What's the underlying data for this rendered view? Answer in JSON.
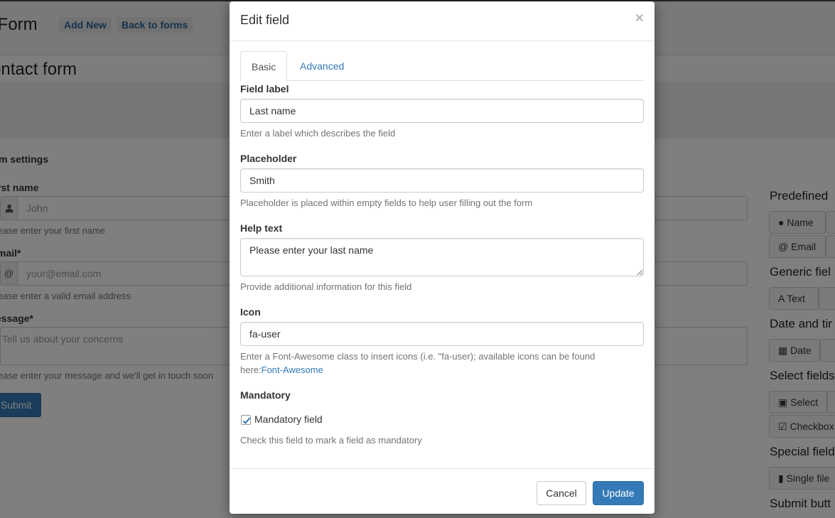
{
  "background": {
    "page_title": "it Form",
    "add_new": "Add New",
    "back_to_forms": "Back to forms",
    "form_title": "ontact form",
    "section_title": "orm settings",
    "fields": {
      "first_name_label": "rst name",
      "first_name_placeholder": "John",
      "first_name_help": "ease enter your first name",
      "email_label": "mail*",
      "email_addon": "@",
      "email_placeholder": "your@email.com",
      "email_help": "ease enter a valid email address",
      "message_label": "essage*",
      "message_placeholder": "Tell us about your concerns",
      "message_help": "ease enter your message and we'll get in touch soon"
    },
    "submit": "Submit",
    "sidebar": {
      "predefined": "Predefined",
      "name_btn": "Name",
      "email_btn": "Email",
      "generic": "Generic fiel",
      "text_btn": "Text",
      "date_time": "Date and tir",
      "date_btn": "Date",
      "select_fields": "Select fields",
      "select_btn": "Select",
      "checkbox_btn": "Checkbox",
      "special": "Special field",
      "single_file_btn": "Single file",
      "submit_btn": "Submit butt"
    }
  },
  "modal": {
    "title": "Edit field",
    "close": "×",
    "tabs": [
      "Basic",
      "Advanced"
    ],
    "field_label": {
      "label": "Field label",
      "value": "Last name",
      "help": "Enter a label which describes the field"
    },
    "placeholder": {
      "label": "Placeholder",
      "value": "Smith",
      "help": "Placeholder is placed within empty fields to help user filling out the form"
    },
    "help_text": {
      "label": "Help text",
      "value": "Please enter your last name",
      "help": "Provide additional information for this field"
    },
    "icon": {
      "label": "Icon",
      "value": "fa-user",
      "help_line1": "Enter a Font-Awesome class to insert icons (i.e. \"fa-user); available icons can be found",
      "help_prefix": "here:",
      "help_link": "Font-Awesome"
    },
    "mandatory": {
      "label": "Mandatory",
      "checkbox_label": "Mandatory field",
      "checked": true,
      "help": "Check this field to mark a field as mandatory"
    },
    "cancel": "Cancel",
    "update": "Update"
  },
  "colors": {
    "primary": "#337ab7",
    "overlay": "rgba(0,0,0,0.5)"
  }
}
